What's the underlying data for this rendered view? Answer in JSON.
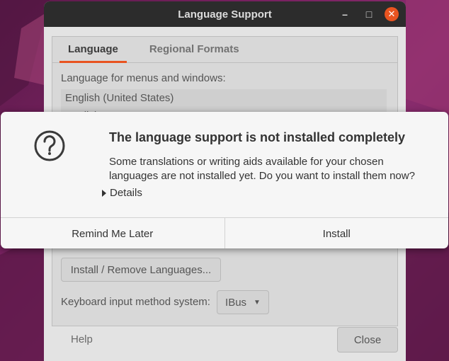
{
  "window": {
    "title": "Language Support",
    "tabs": [
      "Language",
      "Regional Formats"
    ],
    "language_label": "Language for menus and windows:",
    "languages": [
      "English (United States)",
      "English"
    ],
    "install_remove_label": "Install / Remove Languages...",
    "keyboard_label": "Keyboard input method system:",
    "keyboard_value": "IBus",
    "help_label": "Help",
    "close_label": "Close"
  },
  "dialog": {
    "title": "The language support is not installed completely",
    "message": "Some translations or writing aids available for your chosen languages are not installed yet. Do you want to install them now?",
    "details_label": "Details",
    "remind_label": "Remind Me Later",
    "install_label": "Install"
  },
  "colors": {
    "accent": "#e95420",
    "titlebar": "#2c2c2c"
  },
  "icons": [
    "minimize-icon",
    "maximize-icon",
    "close-icon",
    "question-icon",
    "expander-icon",
    "dropdown-caret-icon"
  ]
}
